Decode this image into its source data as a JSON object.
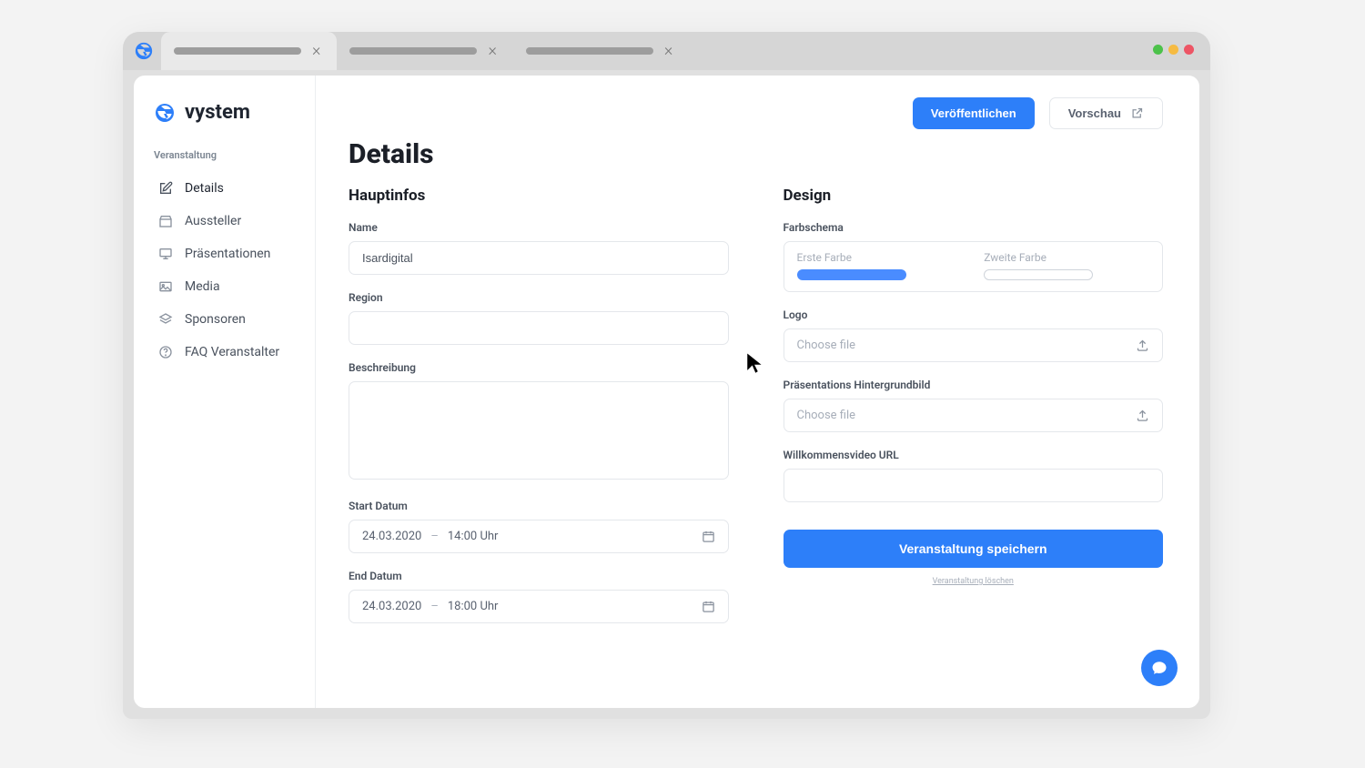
{
  "brand": {
    "name": "vystem"
  },
  "sidebar": {
    "heading": "Veranstaltung",
    "items": [
      {
        "label": "Details"
      },
      {
        "label": "Aussteller"
      },
      {
        "label": "Präsentationen"
      },
      {
        "label": "Media"
      },
      {
        "label": "Sponsoren"
      },
      {
        "label": "FAQ Veranstalter"
      }
    ]
  },
  "topbar": {
    "publish_label": "Veröffentlichen",
    "preview_label": "Vorschau"
  },
  "page": {
    "title": "Details"
  },
  "main_info": {
    "section_title": "Hauptinfos",
    "name_label": "Name",
    "name_value": "Isardigital",
    "region_label": "Region",
    "region_value": "",
    "description_label": "Beschreibung",
    "description_value": "",
    "start_label": "Start Datum",
    "start_date": "24.03.2020",
    "start_time": "14:00 Uhr",
    "end_label": "End Datum",
    "end_date": "24.03.2020",
    "end_time": "18:00 Uhr"
  },
  "design": {
    "section_title": "Design",
    "colorscheme_label": "Farbschema",
    "color1_label": "Erste Farbe",
    "color1_value": "#4a8cff",
    "color2_label": "Zweite Farbe",
    "color2_value": "#ffffff",
    "logo_label": "Logo",
    "logo_placeholder": "Choose file",
    "bg_label": "Präsentations Hintergrundbild",
    "bg_placeholder": "Choose file",
    "video_label": "Willkommensvideo URL",
    "video_value": "",
    "save_label": "Veranstaltung speichern",
    "delete_link": "Veranstaltung löschen"
  }
}
